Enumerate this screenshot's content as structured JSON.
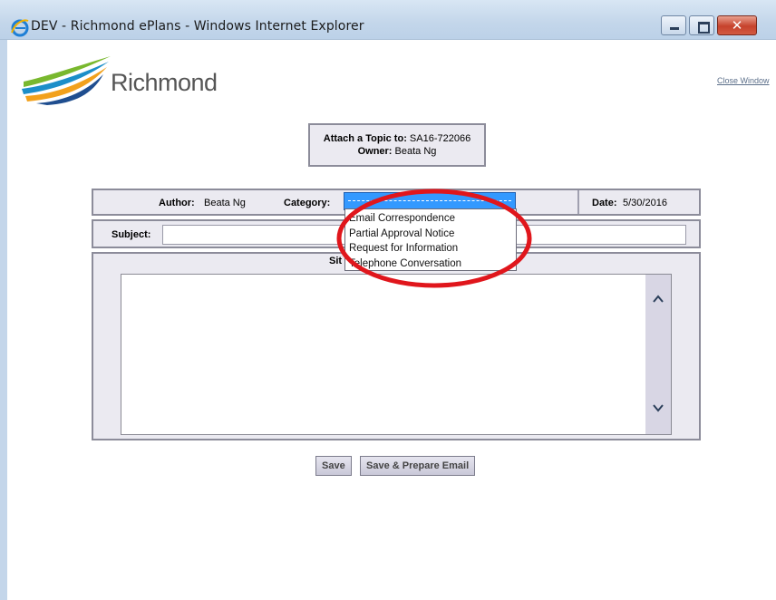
{
  "window": {
    "title": "DEV - Richmond ePlans - Windows Internet Explorer",
    "close_symbol": "✕"
  },
  "header": {
    "logo_text": "Richmond",
    "close_window": "Close Window"
  },
  "topic": {
    "attach_label": "Attach a Topic to:",
    "attach_value": "SA16-722066",
    "owner_label": "Owner:",
    "owner_value": "Beata Ng"
  },
  "form": {
    "author_label": "Author:",
    "author_value": "Beata Ng",
    "category_label": "Category:",
    "category_selected": "---------------------",
    "date_label": "Date:",
    "date_value": "5/30/2016",
    "subject_label": "Subject:",
    "subject_value": "",
    "site_label": "Sit"
  },
  "category_options": [
    "Email Correspondence",
    "Partial Approval Notice",
    "Request for Information",
    "Telephone Conversation"
  ],
  "buttons": {
    "save": "Save",
    "save_email": "Save & Prepare Email"
  },
  "colors": {
    "selection": "#3399ff",
    "panel": "#ebeaf1",
    "annotation": "#e0161c"
  }
}
